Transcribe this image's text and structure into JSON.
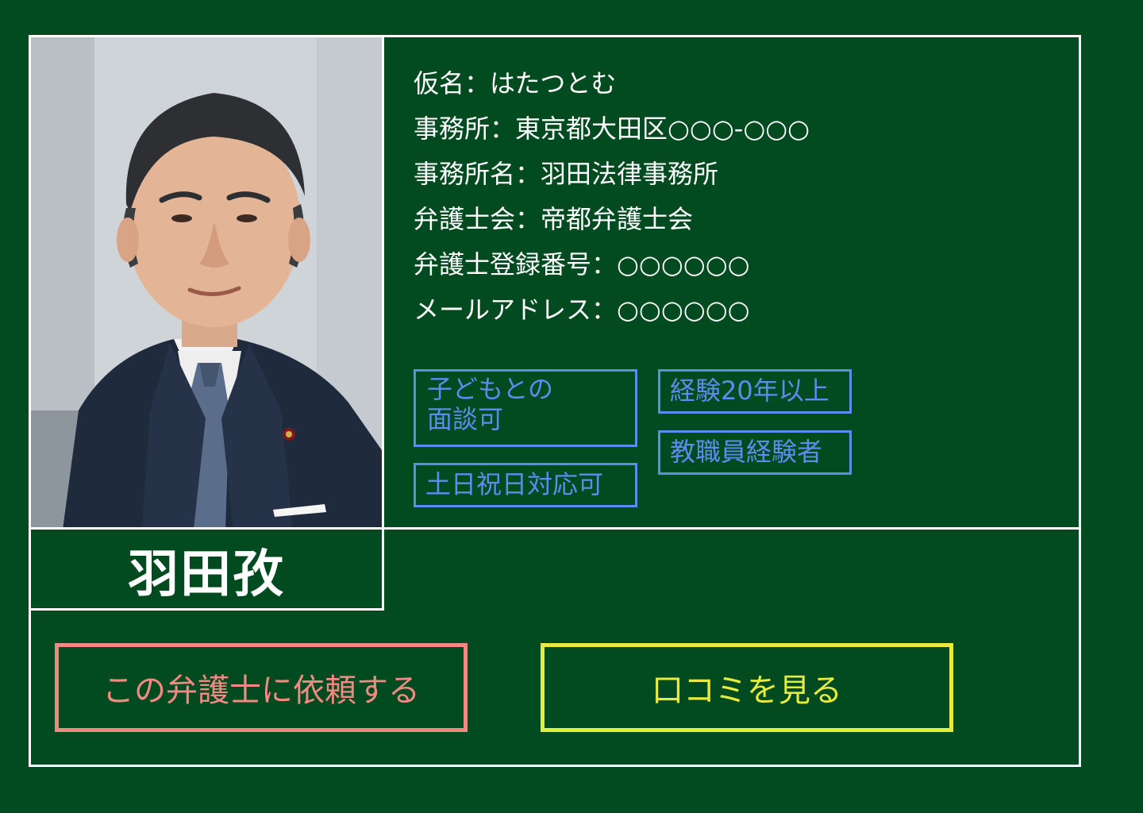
{
  "profile": {
    "name": "羽田孜",
    "photo_alt": "lawyer-portrait"
  },
  "info": {
    "kana": "仮名：はたつとむ",
    "office": "事務所：東京都大田区○○○-○○○",
    "office_name": "事務所名：羽田法律事務所",
    "bar_association": "弁護士会：帝都弁護士会",
    "registration_number": "弁護士登録番号：○○○○○○",
    "email": "メールアドレス：○○○○○○"
  },
  "tags": {
    "child_meeting_line1": "子どもとの",
    "child_meeting_line2": "面談可",
    "experience": "経験20年以上",
    "teacher": "教職員経験者",
    "weekends": "土日祝日対応可"
  },
  "actions": {
    "request_label": "この弁護士に依頼する",
    "reviews_label": "口コミを見る"
  },
  "colors": {
    "background": "#024a1f",
    "border": "#ffffff",
    "tag": "#5b8def",
    "request_button": "#f08a82",
    "reviews_button": "#e6ec3e"
  }
}
